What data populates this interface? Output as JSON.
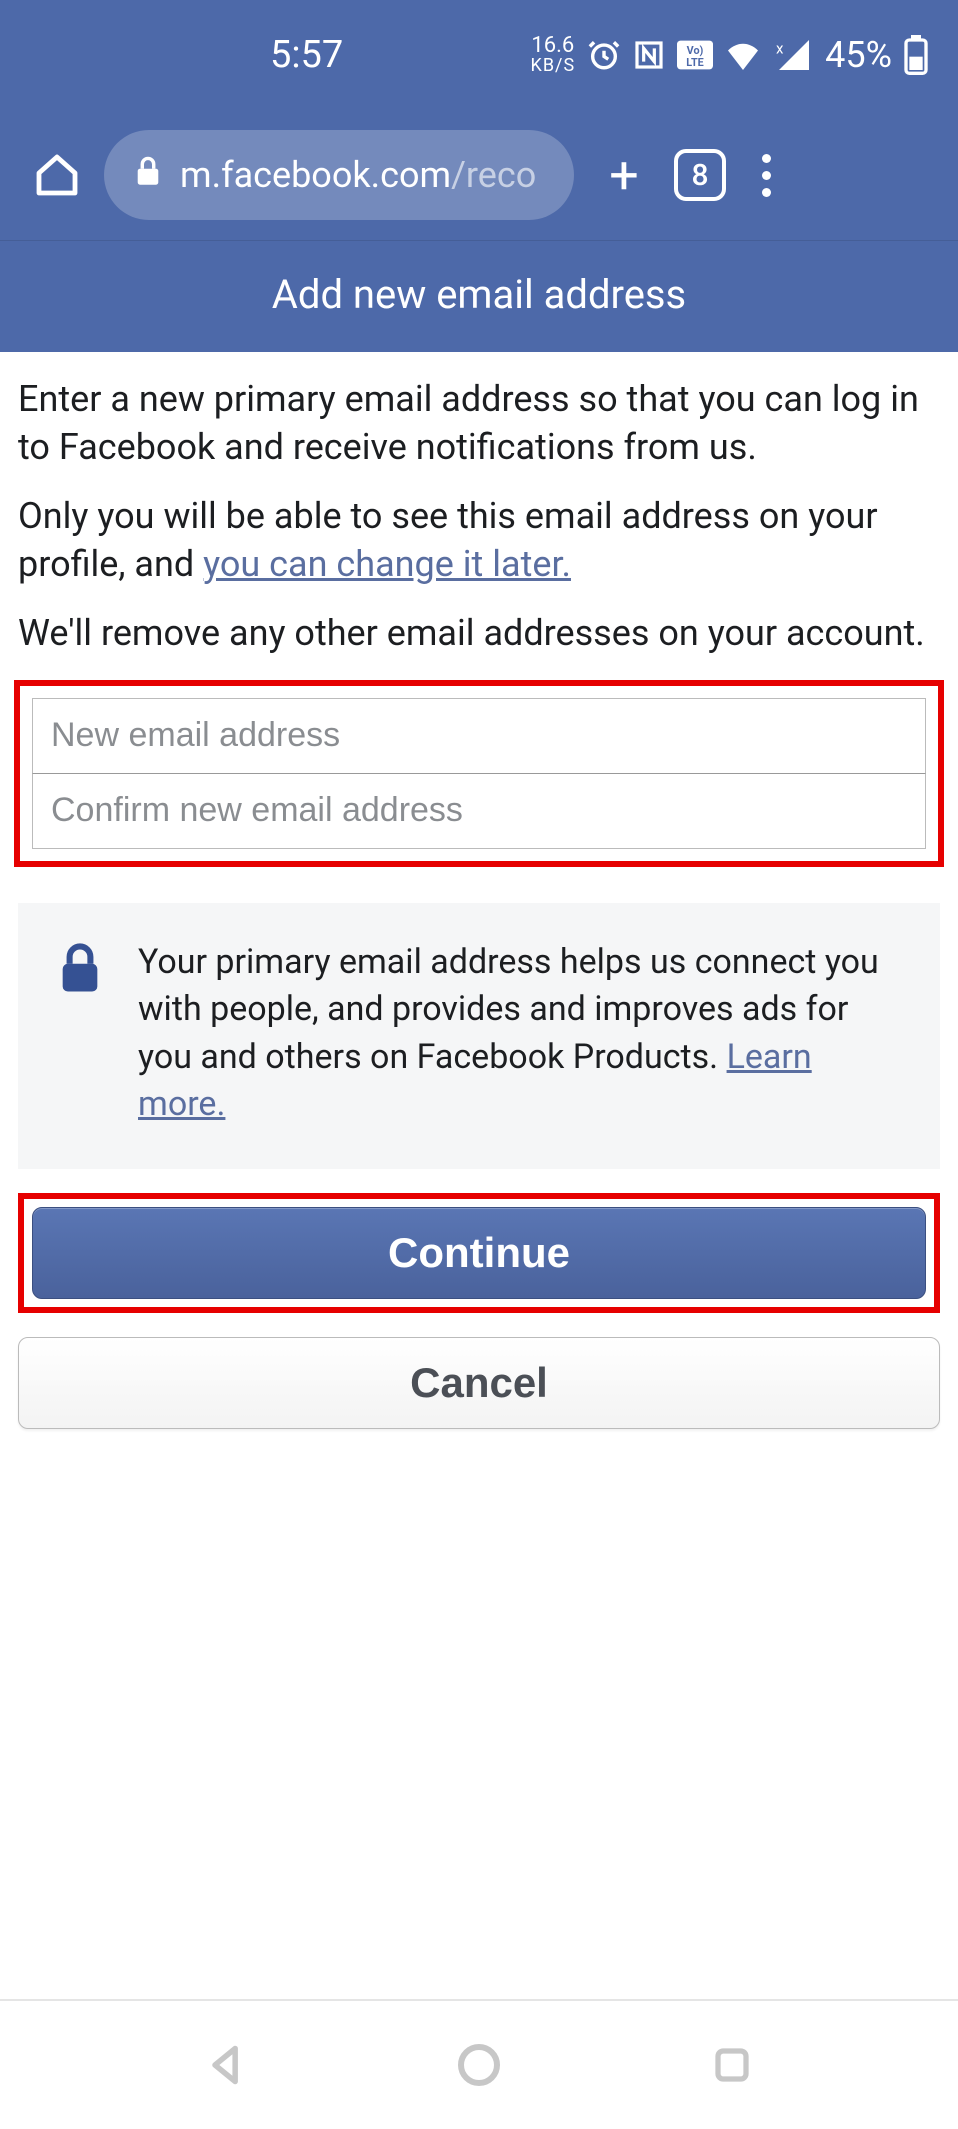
{
  "status": {
    "time": "5:57",
    "net_speed": "16.6",
    "net_unit": "KB/S",
    "battery_pct": "45%"
  },
  "browser": {
    "url_host": "m.facebook.com",
    "url_path": "/reco",
    "tab_count": "8"
  },
  "page": {
    "title": "Add new email address",
    "intro": "Enter a new primary email address so that you can log in to Facebook and receive notifications from us.",
    "privacy_pre": "Only you will be able to see this email address on your profile, and ",
    "privacy_link": "you can change it later.",
    "remove_note": "We'll remove any other email addresses on your account.",
    "input_new_placeholder": "New email address",
    "input_confirm_placeholder": "Confirm new email address",
    "info_text": "Your primary email address helps us connect you with people, and provides and improves ads for you and others on Facebook Products. ",
    "info_link": "Learn more.",
    "continue_label": "Continue",
    "cancel_label": "Cancel"
  }
}
